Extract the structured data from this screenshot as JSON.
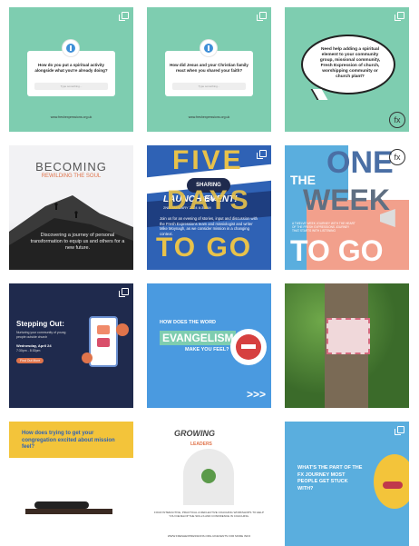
{
  "tiles": [
    {
      "question": "How do you put a spiritual activity alongside what you're already doing?",
      "input": "Type something...",
      "handle": "www.freshexpressions.org.uk"
    },
    {
      "question": "How did Jesus and your Christian family react when you shared your faith?",
      "input": "Type something...",
      "handle": "www.freshexpressions.org.uk"
    },
    {
      "text": "Need help adding a spiritual element to your community group, missional community, Fresh Expression of church, worshipping community or church plant?",
      "logo": "fx"
    },
    {
      "title": "BECOMING",
      "subtitle": "REWILDING THE SOUL",
      "body": "Discovering a journey of personal transformation to equip us and others for a new future."
    },
    {
      "w1": "FIVE",
      "w2": "DAYS",
      "w3": "TO GO",
      "badge": "SHARING JESUS",
      "launch": "LAUNCH EVENT!",
      "date": "2ND JANUARY 2024 6:30PM",
      "blurb": "Join us for an evening of stories, input and discussion with the Fresh Expressions team and missiologist and writer Mike Moynagh, as we consider mission in a changing context."
    },
    {
      "w1": "ONE",
      "w2": "WEEK",
      "w3": "TO GO",
      "the": "THE",
      "logo": "fx",
      "blurb": "A TWELVE WEEK JOURNEY WITH THE HEART OF THE FRESH EXPRESSIONS JOURNEY THAT STARTS WITH LISTENING"
    },
    {
      "title": "Stepping Out:",
      "sub": "Nurturing your community of young people outside church",
      "date": "Wednesday, April 24",
      "time": "7:30pm - 8:30pm",
      "cta": "Find Out More"
    },
    {
      "q1": "HOW DOES THE WORD",
      "word": "EVANGELISM",
      "q2": "MAKE YOU FEEL?",
      "arrows": ">>>"
    },
    {
      "alt": "Sign on tree"
    },
    {
      "text": "How does trying to get your congregation excited about mission feel?"
    },
    {
      "title": "GROWING",
      "sub": "LEADERS",
      "body": "FOUR INTERACTIVE, PRACTICAL & REFLECTIVE COACHING WORKSHOPS TO HELP YOU DEVELOP THE SKILLS AND CONFIDENCE IN COACHING.",
      "footer": "WWW.FRESHEXPRESSIONS.ORG.UK/EVENTS FOR MORE INFO"
    },
    {
      "text": "WHAT'S THE PART OF THE FX JOURNEY MOST PEOPLE GET STUCK WITH?"
    }
  ],
  "colors": {
    "teal": "#7ecdb0",
    "blue": "#2f62b5",
    "yellow": "#e8c24a",
    "navy": "#1f2a4d",
    "sky": "#4a9ae0",
    "orange": "#e0744b"
  }
}
